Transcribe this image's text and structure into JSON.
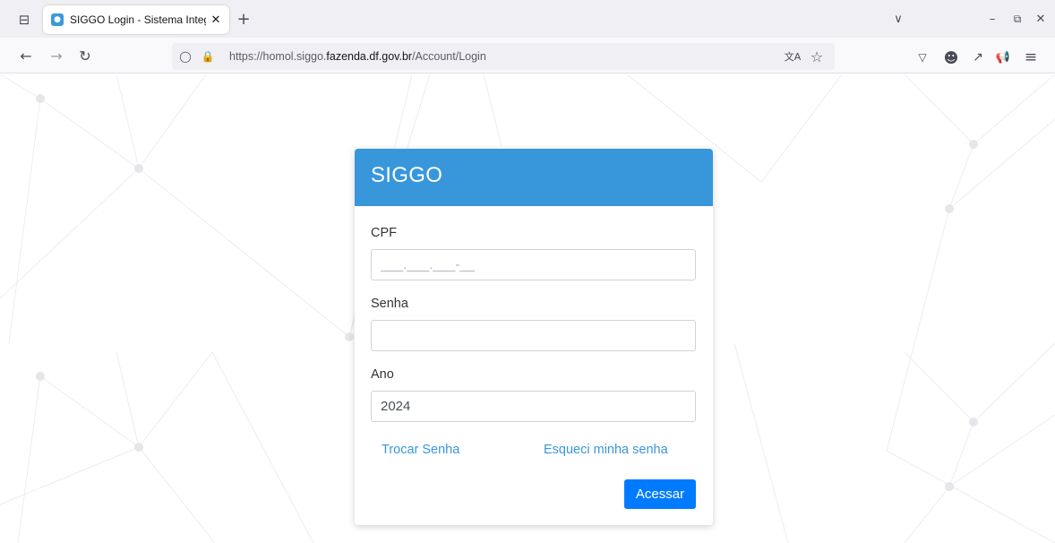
{
  "browser": {
    "tab": {
      "title": "SIGGO Login - Sistema Integral",
      "close": "✕"
    },
    "new_tab": "+",
    "url_prefix": "https://homol.siggo.",
    "url_domain": "fazenda.df.gov.br",
    "url_path": "/Account/Login",
    "window_controls": {
      "dropdown": "∨",
      "minimize": "–",
      "restore": "⧉",
      "close": "✕"
    },
    "icons": {
      "tab_overview": "⊟",
      "back": "←",
      "forward": "→",
      "reload": "↻",
      "shield": "◯",
      "lock": "🔒",
      "translate": "文A",
      "star": "☆",
      "pocket": "▽",
      "account": "☻",
      "extensions": "↗",
      "megaphone": "📢",
      "menu": "≡"
    }
  },
  "login": {
    "title": "SIGGO",
    "cpf_label": "CPF",
    "cpf_placeholder": "___.___.___-__",
    "senha_label": "Senha",
    "senha_value": "",
    "ano_label": "Ano",
    "ano_value": "2024",
    "trocar_senha": "Trocar Senha",
    "esqueci_senha": "Esqueci minha senha",
    "submit": "Acessar"
  },
  "colors": {
    "header": "#3897db",
    "button": "#007bff",
    "link": "#3897db"
  }
}
